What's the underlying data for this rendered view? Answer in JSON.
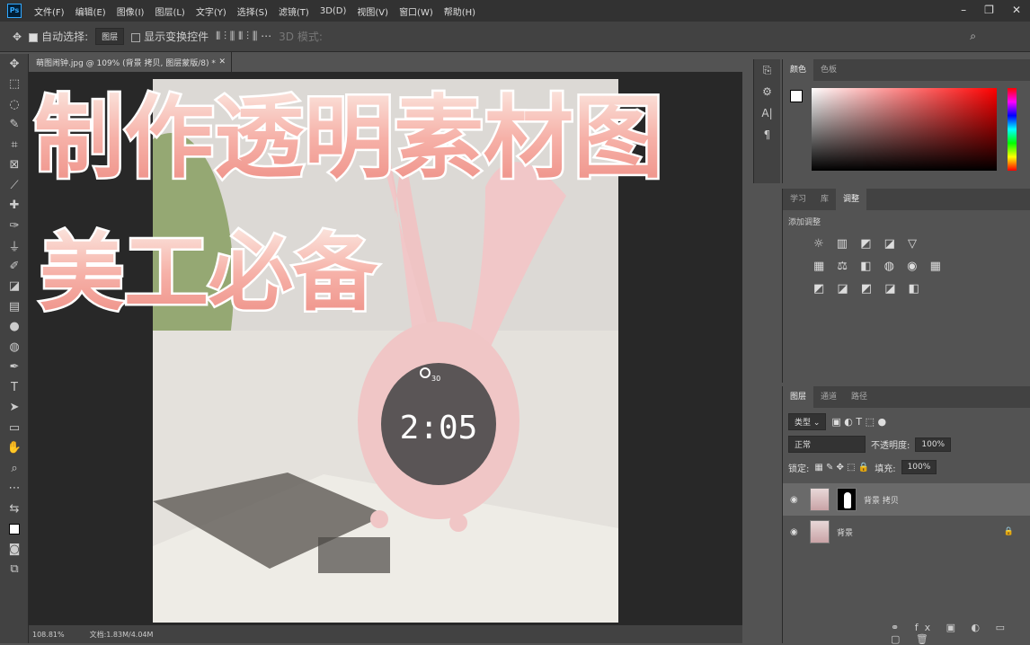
{
  "app": {
    "logo": "Ps",
    "menu": [
      "文件(F)",
      "编辑(E)",
      "图像(I)",
      "图层(L)",
      "文字(Y)",
      "选择(S)",
      "滤镜(T)",
      "3D(D)",
      "视图(V)",
      "窗口(W)",
      "帮助(H)"
    ]
  },
  "options": {
    "auto_select": "自动选择:",
    "layer_dd": "图层",
    "show_transform": "显示变换控件",
    "mode3d": "3D 模式:"
  },
  "doc": {
    "tab": "萌图闹钟.jpg @ 109% (背景 拷贝, 图层蒙版/8) *",
    "zoom": "108.81%",
    "docsize": "文档:1.83M/4.04M"
  },
  "overlay": {
    "line1": "制作透明素材图",
    "line2": "美工必备"
  },
  "clock": {
    "time": "2:05",
    "label": "30"
  },
  "color_panel": {
    "tabs": [
      "颜色",
      "色板"
    ]
  },
  "adjust_panel": {
    "tabs": [
      "学习",
      "库",
      "调整"
    ],
    "title": "添加调整"
  },
  "layers_panel": {
    "tabs": [
      "图层",
      "通道",
      "路径"
    ],
    "kind": "类型",
    "blend": "正常",
    "opacity_label": "不透明度:",
    "opacity": "100%",
    "lock_label": "锁定:",
    "fill_label": "填充:",
    "fill": "100%",
    "layers": [
      {
        "name": "背景 拷贝"
      },
      {
        "name": "背景"
      }
    ]
  },
  "colors": {
    "accent": "#f4a6a0",
    "title_fill": "#f6b7b0"
  }
}
